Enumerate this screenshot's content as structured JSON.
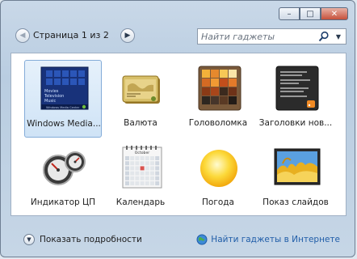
{
  "window": {
    "controls": {
      "minimize": "–",
      "maximize": "□",
      "close": "✕"
    }
  },
  "toolbar": {
    "page_info": "Страница 1 из 2",
    "search_placeholder": "Найти гаджеты"
  },
  "gadgets": [
    {
      "label": "Windows Media...",
      "icon": "windows-media-center-icon",
      "selected": true,
      "thumb_text": [
        "Movies",
        "Television",
        "Music"
      ],
      "thumb_bar": "Windows Media Center"
    },
    {
      "label": "Валюта",
      "icon": "currency-icon",
      "selected": false
    },
    {
      "label": "Головоломка",
      "icon": "puzzle-icon",
      "selected": false
    },
    {
      "label": "Заголовки нов...",
      "icon": "news-headlines-icon",
      "selected": false
    },
    {
      "label": "Индикатор ЦП",
      "icon": "cpu-meter-icon",
      "selected": false
    },
    {
      "label": "Календарь",
      "icon": "calendar-icon",
      "selected": false,
      "month": "October",
      "days": [
        "Sun",
        "Mon",
        "Tue",
        "Wed",
        "Thu",
        "Fri",
        "Sat"
      ]
    },
    {
      "label": "Погода",
      "icon": "weather-sun-icon",
      "selected": false
    },
    {
      "label": "Показ слайдов",
      "icon": "slideshow-icon",
      "selected": false
    }
  ],
  "footer": {
    "show_details": "Показать подробности",
    "get_online": "Найти гаджеты в Интернете"
  },
  "colors": {
    "accent": "#1f5da8",
    "selected_bg": "#cfe3f6"
  }
}
